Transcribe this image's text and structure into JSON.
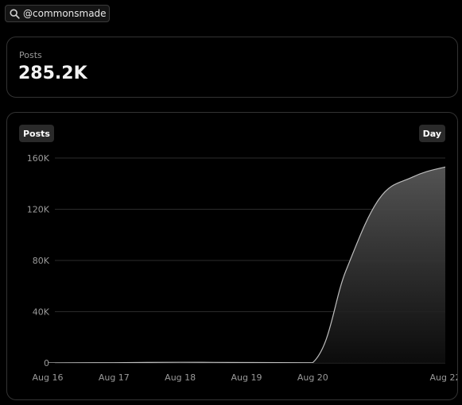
{
  "search": {
    "value": "@commonsmade",
    "icon": "search-icon"
  },
  "stat": {
    "label": "Posts",
    "value": "285.2K"
  },
  "chart_controls": {
    "metric_label": "Posts",
    "range_label": "Day"
  },
  "colors": {
    "background": "#000000",
    "card_border": "#333333",
    "line": "#bdbdbd",
    "gridline": "#2b2b2b",
    "tick_text": "#9a9a9a"
  },
  "chart_data": {
    "type": "area",
    "title": "",
    "xlabel": "",
    "ylabel": "",
    "grid": true,
    "ylim": [
      0,
      160000
    ],
    "yticks": [
      0,
      40000,
      80000,
      120000,
      160000
    ],
    "ytick_labels": [
      "0",
      "40K",
      "80K",
      "120K",
      "160K"
    ],
    "xlim": [
      "2024-08-16",
      "2024-08-22"
    ],
    "xtick_labels": [
      {
        "date": "2024-08-16",
        "label": "Aug 16"
      },
      {
        "date": "2024-08-17",
        "label": "Aug 17"
      },
      {
        "date": "2024-08-18",
        "label": "Aug 18"
      },
      {
        "date": "2024-08-19",
        "label": "Aug 19"
      },
      {
        "date": "2024-08-20",
        "label": "Aug 20"
      },
      {
        "date": "2024-08-22",
        "label": "Aug 22"
      }
    ],
    "series": [
      {
        "points": [
          {
            "x": "2024-08-16T00:00",
            "y": 0
          },
          {
            "x": "2024-08-17T00:00",
            "y": 200
          },
          {
            "x": "2024-08-18T00:00",
            "y": 500
          },
          {
            "x": "2024-08-19T00:00",
            "y": 300
          },
          {
            "x": "2024-08-20T00:00",
            "y": 200
          },
          {
            "x": "2024-08-20T12:00",
            "y": 72000
          },
          {
            "x": "2024-08-21T00:00",
            "y": 128000
          },
          {
            "x": "2024-08-21T12:00",
            "y": 145000
          },
          {
            "x": "2024-08-22T00:00",
            "y": 153000
          },
          {
            "x": "2024-08-22T12:00",
            "y": 157000
          }
        ]
      }
    ]
  }
}
